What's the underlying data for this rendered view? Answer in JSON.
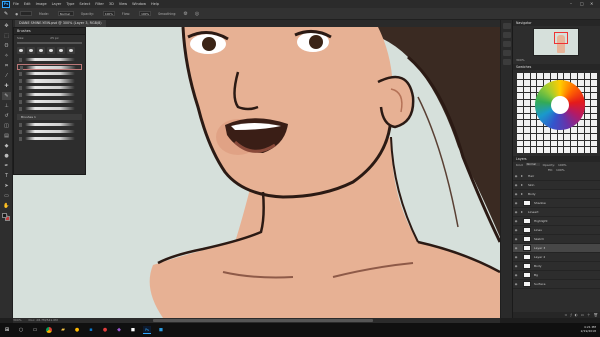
{
  "app": {
    "logo": "Ps",
    "menu": [
      "File",
      "Edit",
      "Image",
      "Layer",
      "Type",
      "Select",
      "Filter",
      "3D",
      "View",
      "Window",
      "Help"
    ],
    "window_controls": [
      "–",
      "□",
      "✕"
    ]
  },
  "options_bar": {
    "items": [
      "Mode:",
      "Normal",
      "Opacity:",
      "100%",
      "Flow:",
      "100%",
      "Smoothing:"
    ]
  },
  "document": {
    "tab_title": "DIANE SMINE-YEIN.psd @ 300% (Layer 3, RGB/8)"
  },
  "status": {
    "zoom": "300%",
    "doc": "Doc: 28.7M/541.0M"
  },
  "brushes": {
    "title": "Brushes",
    "size_label": "Size:",
    "size_value": "25 px",
    "group_label": "Brushes 1"
  },
  "navigator": {
    "title": "Navigator",
    "zoom": "300%"
  },
  "swatches": {
    "title": "Swatches"
  },
  "layers": {
    "title": "Layers",
    "kind_label": "Kind",
    "blend_mode": "Normal",
    "opacity_label": "Opacity:",
    "opacity": "100%",
    "fill_label": "Fill:",
    "fill": "100%",
    "items": [
      {
        "name": "Hair",
        "type": "folder"
      },
      {
        "name": "Skin",
        "type": "folder"
      },
      {
        "name": "Body",
        "type": "folder"
      },
      {
        "name": "Shadow",
        "type": "layer"
      },
      {
        "name": "Lineart",
        "type": "folder"
      },
      {
        "name": "Highlight",
        "type": "layer"
      },
      {
        "name": "Lines",
        "type": "layer"
      },
      {
        "name": "Sketch",
        "type": "layer"
      },
      {
        "name": "Layer 3",
        "type": "layer",
        "selected": true
      },
      {
        "name": "Layer 2",
        "type": "layer"
      },
      {
        "name": "Body",
        "type": "layer"
      },
      {
        "name": "Bg",
        "type": "layer"
      },
      {
        "name": "Surface",
        "type": "layer"
      }
    ]
  },
  "taskbar": {
    "time": "4:21 PM",
    "date": "2/19/2018"
  },
  "colors": {
    "canvas_bg": "#d6e0db",
    "skin": "#e7b194",
    "hair": "#3a2a22",
    "outline": "#2b1a14",
    "accent": "#31a8ff"
  }
}
